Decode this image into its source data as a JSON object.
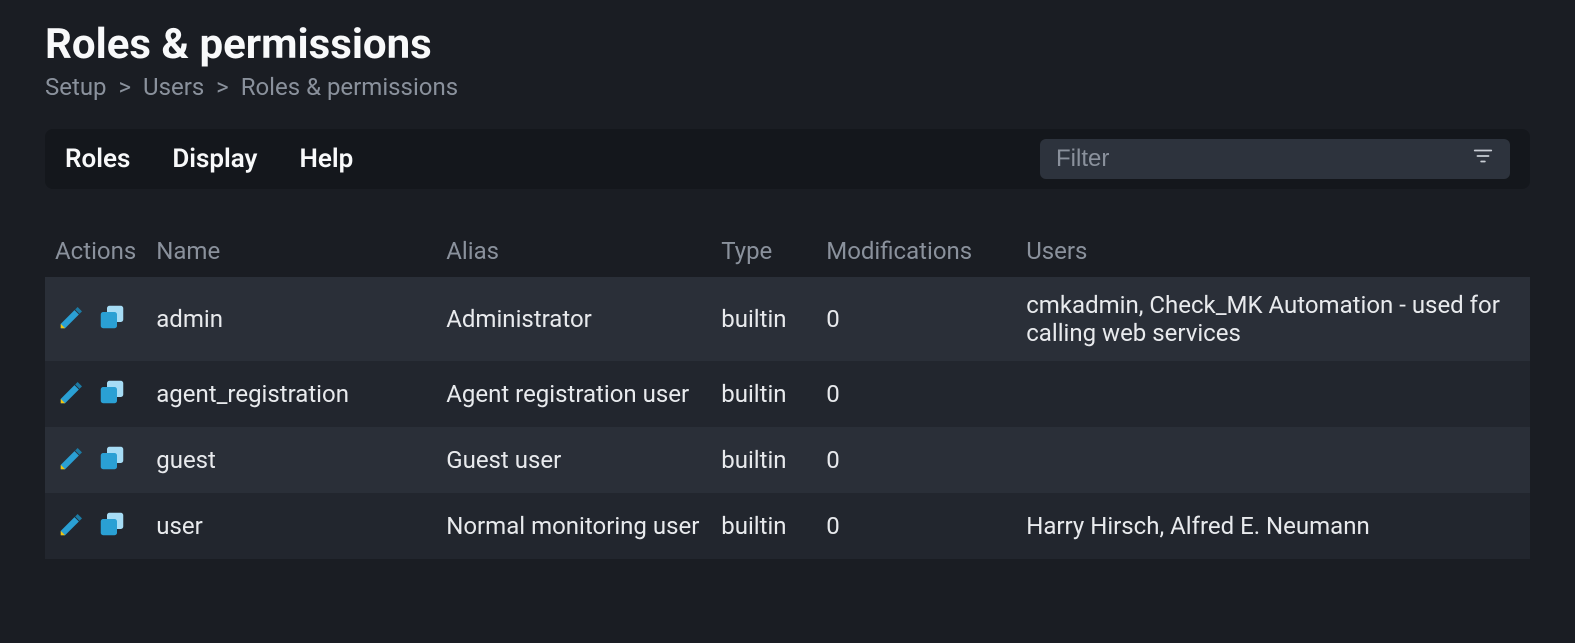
{
  "page": {
    "title": "Roles & permissions",
    "breadcrumb": [
      "Setup",
      "Users",
      "Roles & permissions"
    ]
  },
  "toolbar": {
    "items": [
      "Roles",
      "Display",
      "Help"
    ],
    "filter_placeholder": "Filter"
  },
  "table": {
    "headers": [
      "Actions",
      "Name",
      "Alias",
      "Type",
      "Modifications",
      "Users"
    ],
    "rows": [
      {
        "name": "admin",
        "alias": "Administrator",
        "type": "builtin",
        "modifications": "0",
        "users": "cmkadmin, Check_MK Automation - used for calling web services"
      },
      {
        "name": "agent_registration",
        "alias": "Agent registration user",
        "type": "builtin",
        "modifications": "0",
        "users": ""
      },
      {
        "name": "guest",
        "alias": "Guest user",
        "type": "builtin",
        "modifications": "0",
        "users": ""
      },
      {
        "name": "user",
        "alias": "Normal monitoring user",
        "type": "builtin",
        "modifications": "0",
        "users": "Harry Hirsch, Alfred E. Neumann"
      }
    ]
  }
}
